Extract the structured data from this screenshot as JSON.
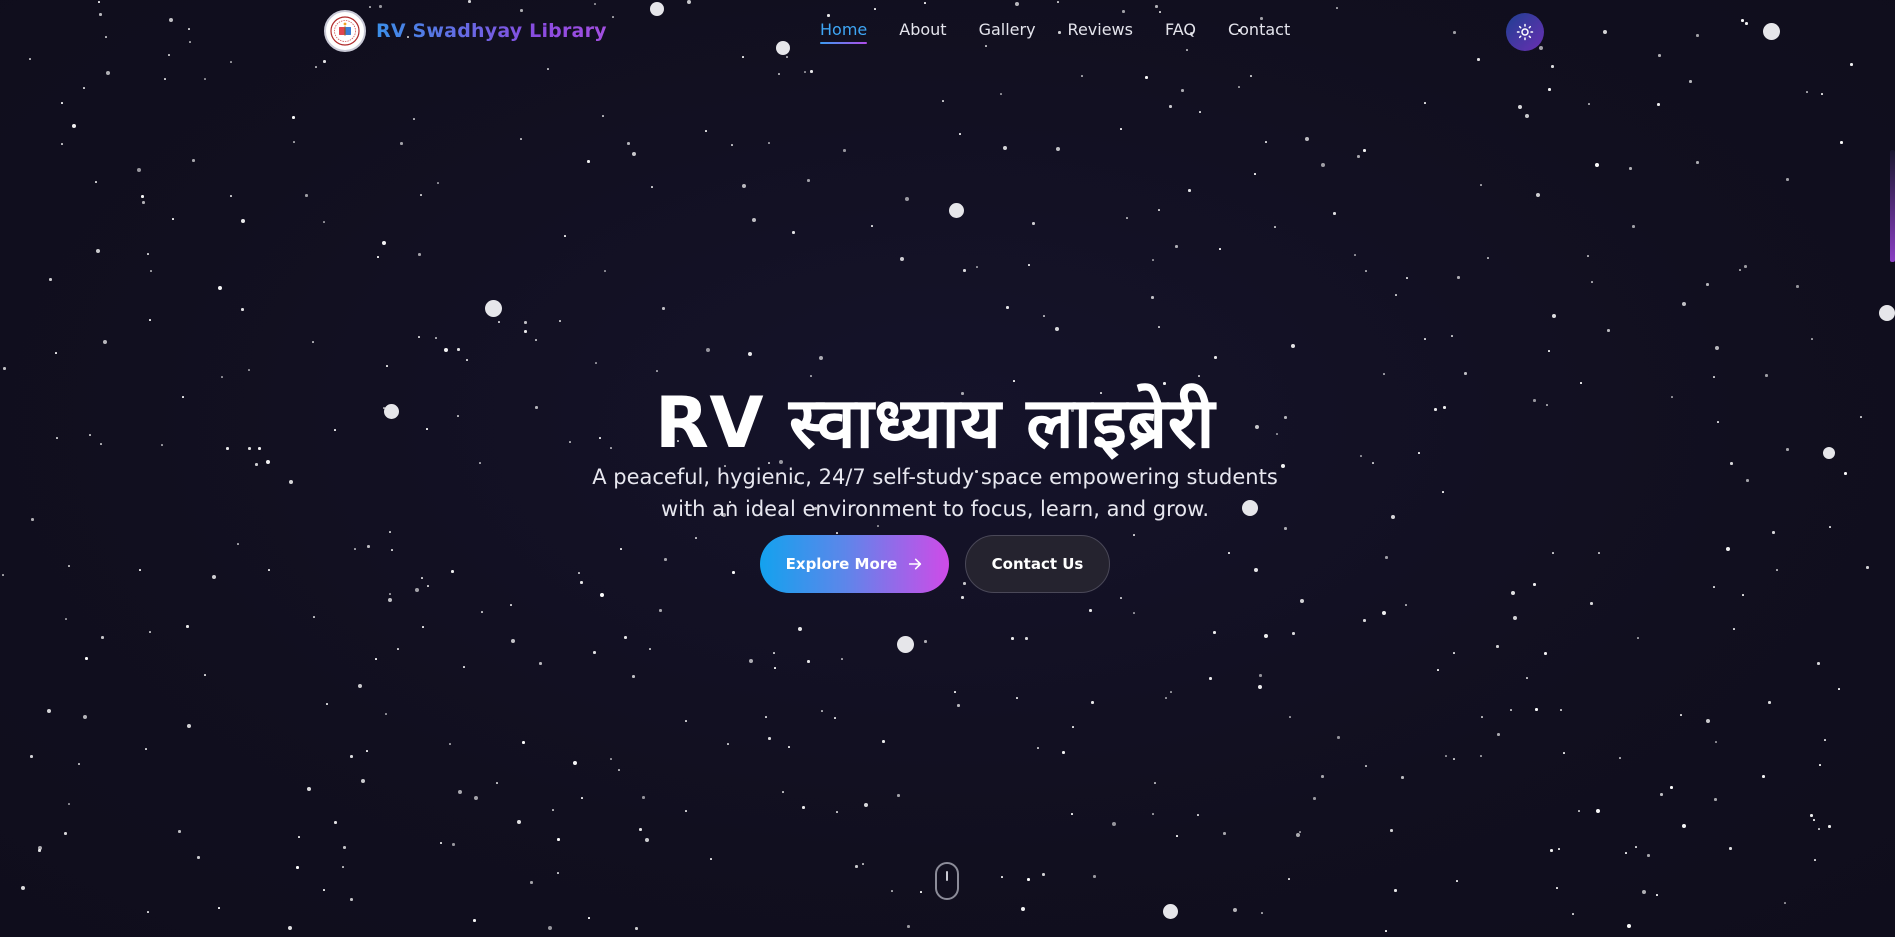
{
  "brand": {
    "name": "RV Swadhyay Library",
    "logo_icon": "library-seal-icon"
  },
  "nav": {
    "links": [
      {
        "label": "Home",
        "active": true
      },
      {
        "label": "About",
        "active": false
      },
      {
        "label": "Gallery",
        "active": false
      },
      {
        "label": "Reviews",
        "active": false
      },
      {
        "label": "FAQ",
        "active": false
      },
      {
        "label": "Contact",
        "active": false
      }
    ],
    "theme_toggle_icon": "sun-icon"
  },
  "hero": {
    "title": "RV स्वाध्याय लाइब्रेरी",
    "subtitle": "A peaceful, hygienic, 24/7 self-study space empowering students with an ideal environment to focus, learn, and grow.",
    "primary_button": "Explore More",
    "primary_button_icon": "arrow-right-icon",
    "secondary_button": "Contact Us",
    "scroll_icon": "mouse-scroll-icon"
  },
  "colors": {
    "background": "#110f1f",
    "accent_blue": "#3ea6f5",
    "accent_purple": "#cf4be8",
    "text": "#ffffff"
  }
}
